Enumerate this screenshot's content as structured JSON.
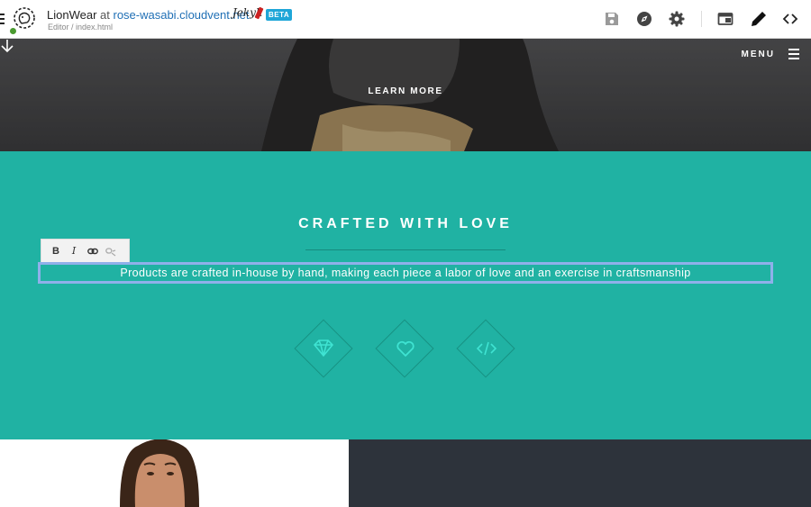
{
  "topbar": {
    "site_name": "LionWear",
    "at": " at ",
    "host": "rose-wasabi.cloudvent.net",
    "ssg_logo_text": "Jekyll",
    "beta_badge": "BETA",
    "breadcrumb": "Editor / index.html",
    "icons": [
      "menu-icon",
      "site-logo",
      "save-icon",
      "compass-icon",
      "gear-icon",
      "layout-icon",
      "pencil-icon",
      "code-icon"
    ]
  },
  "hero": {
    "menu_label": "MENU",
    "learn_more": "LEARN MORE"
  },
  "features": {
    "heading": "CRAFTED WITH LOVE",
    "body": "Products are crafted in-house by hand, making each piece a labor of love and an exercise in craftsmanship",
    "format_buttons": [
      "B",
      "I"
    ],
    "icons": [
      "diamond-gem-icon",
      "heart-icon",
      "code-brackets-icon"
    ]
  },
  "colors": {
    "teal": "#20b2a3",
    "dark_panel": "#2d333b",
    "icon_accent": "#3fe3d2",
    "edit_outline": "#8fb0ea",
    "beta_blue": "#1fa6d8",
    "host_link": "#1f6fb5"
  }
}
